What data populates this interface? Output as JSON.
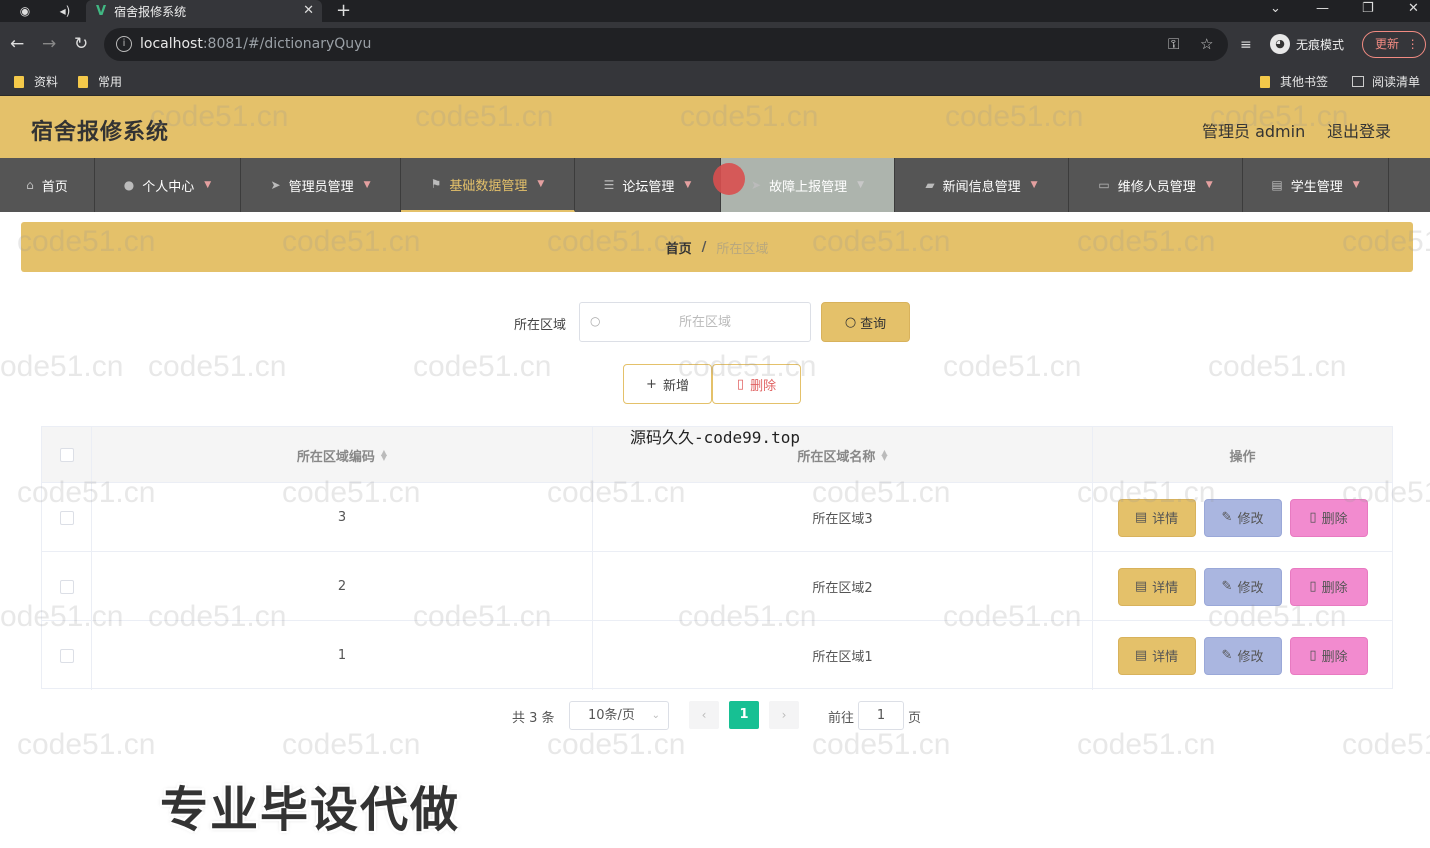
{
  "browser": {
    "tab_title": "宿舍报修系统",
    "url_host": "localhost",
    "url_rest": ":8081/#/dictionaryQuyu",
    "profile_label": "无痕模式",
    "update_label": "更新",
    "bookmarks": [
      "资料",
      "常用"
    ],
    "other_bookmarks": "其他书签",
    "reading_list": "阅读清单"
  },
  "header": {
    "title": "宿舍报修系统",
    "user": "管理员 admin",
    "logout": "退出登录"
  },
  "nav": {
    "items": [
      {
        "label": "首页",
        "icon": "home-icon"
      },
      {
        "label": "个人中心",
        "icon": "user-icon"
      },
      {
        "label": "管理员管理",
        "icon": "send-icon"
      },
      {
        "label": "基础数据管理",
        "icon": "flag-icon"
      },
      {
        "label": "论坛管理",
        "icon": "sliders-icon"
      },
      {
        "label": "故障上报管理",
        "icon": "send-icon"
      },
      {
        "label": "新闻信息管理",
        "icon": "wallet-icon"
      },
      {
        "label": "维修人员管理",
        "icon": "monitor-icon"
      },
      {
        "label": "学生管理",
        "icon": "chat-icon"
      }
    ]
  },
  "breadcrumb": {
    "home": "首页",
    "separator": "/",
    "current": "所在区域"
  },
  "search": {
    "label": "所在区域",
    "placeholder": "所在区域",
    "button": "查询"
  },
  "actions": {
    "add": "新增",
    "delete": "删除"
  },
  "overlay_text": "源码久久-code99.top",
  "table": {
    "headers": {
      "code": "所在区域编码",
      "name": "所在区域名称",
      "ops": "操作"
    },
    "rows": [
      {
        "code": "3",
        "name": "所在区域3"
      },
      {
        "code": "2",
        "name": "所在区域2"
      },
      {
        "code": "1",
        "name": "所在区域1"
      }
    ],
    "op_labels": {
      "detail": "详情",
      "edit": "修改",
      "delete": "删除"
    }
  },
  "pagination": {
    "total": "共 3 条",
    "page_size": "10条/页",
    "current_page": "1",
    "goto_label": "前往",
    "goto_value": "1",
    "page_suffix": "页"
  },
  "promo_text": "专业毕设代做",
  "watermark": "code51.cn",
  "colors": {
    "header_bg": "#e4c16a",
    "nav_bg": "#555555",
    "pager_active": "#17c093",
    "edit_btn": "#aab6e0",
    "delete_btn": "#f28bcf"
  }
}
